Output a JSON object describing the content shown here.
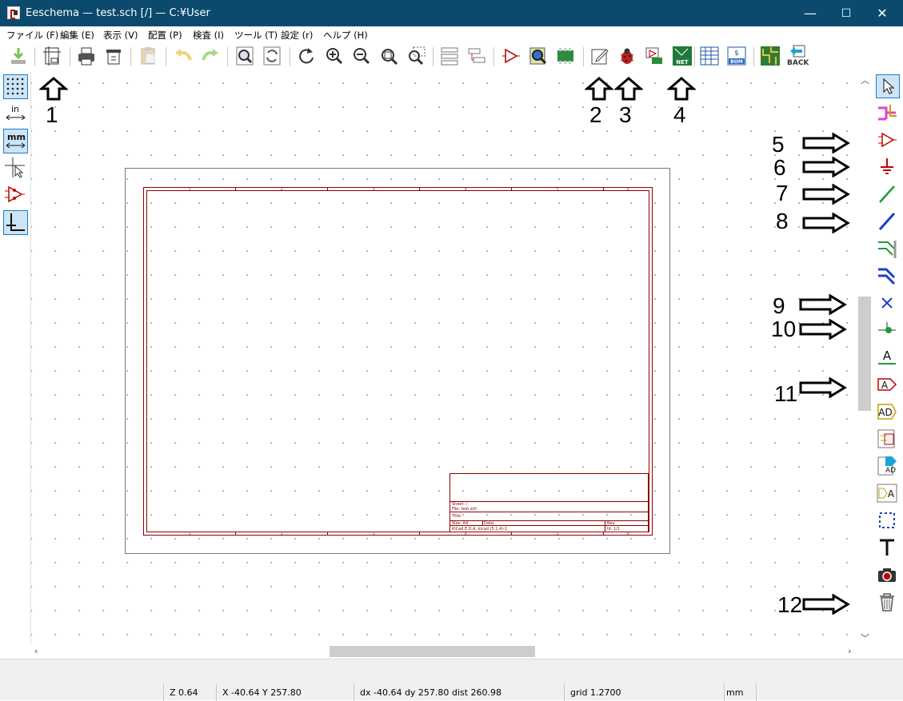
{
  "window": {
    "title": "Eeschema — test.sch [/] — C:¥User",
    "minimize": "—",
    "maximize": "☐",
    "close": "✕"
  },
  "menubar": {
    "items": [
      "ファイル (F)",
      "編集 (E)",
      "表示 (V)",
      "配置 (P)",
      "検査 (I)",
      "ツール (T)",
      "設定 (r)",
      "ヘルプ (H)"
    ]
  },
  "toolbar": {
    "buttons": [
      "save-icon",
      "page-settings-icon",
      "print-icon",
      "plot-icon",
      "paste-icon",
      "undo-icon",
      "redo-icon",
      "find-icon",
      "find-replace-icon",
      "refresh-icon",
      "zoom-in-icon",
      "zoom-out-icon",
      "zoom-fit-icon",
      "zoom-selection-icon",
      "hierarchy-navigator-icon",
      "leave-sheet-icon",
      "symbol-editor-icon",
      "symbol-browser-icon",
      "footprint-assign-icon",
      "annotate-icon",
      "erc-icon",
      "assign-footprints-icon",
      "netlist-icon",
      "bom-icon",
      "bom-export-icon",
      "pcbnew-icon",
      "back-icon"
    ],
    "back_label": "BACK",
    "net_label": "NET",
    "bom_label": "BOM"
  },
  "lefttoolbar": {
    "in_label": "in",
    "mm_label": "mm"
  },
  "annotations": [
    "1",
    "2",
    "3",
    "4",
    "5",
    "6",
    "7",
    "8",
    "9",
    "10",
    "11",
    "12"
  ],
  "sheet": {
    "border_numbers": [
      "1",
      "2",
      "3",
      "4",
      "5",
      "6"
    ],
    "sheet_label": "Sheet: /",
    "file_label": "File: test.sch",
    "title_label": "Title:",
    "size_label": "Size: A4",
    "date_label": "Date:",
    "rev_label": "Rev:",
    "kicad_label": "KiCad E.D.A.  kicad (5.1.4)-1",
    "id_label": "Id: 1/1"
  },
  "statusbar": {
    "zoom": "Z 0.64",
    "xy": "X -40.64  Y 257.80",
    "delta": "dx -40.64  dy 257.80  dist 260.98",
    "grid": "grid 1.2700",
    "units": "mm"
  },
  "colors": {
    "titlebar": "#0b4a6d",
    "schematic_red": "#8b0000",
    "active_bg": "#cce4f7"
  }
}
